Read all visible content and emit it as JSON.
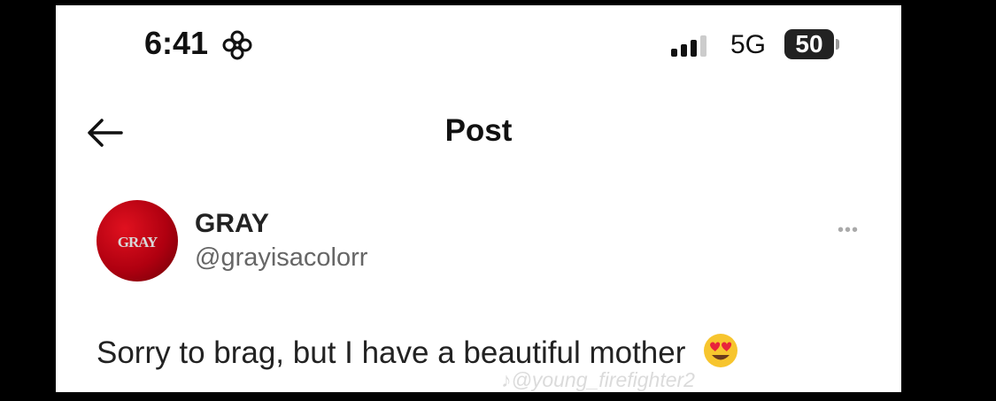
{
  "status_bar": {
    "time": "6:41",
    "focus_icon": "flower-focus-icon",
    "signal_icon": "cellular-signal-icon",
    "network": "5G",
    "battery": "50"
  },
  "header": {
    "back_icon": "back-arrow-icon",
    "title": "Post"
  },
  "post": {
    "avatar_text": "GRAY",
    "display_name": "GRAY",
    "handle": "@grayisacolorr",
    "more_icon": "more-options-icon",
    "text": "Sorry to brag, but I have a beautiful mother",
    "emoji_icon": "heart-eyes-emoji-icon"
  },
  "watermark": "♪@young_firefighter2",
  "colors": {
    "background": "#000000",
    "card": "#ffffff",
    "avatar_red": "#c0101a",
    "text": "#222222",
    "secondary": "#666666"
  }
}
